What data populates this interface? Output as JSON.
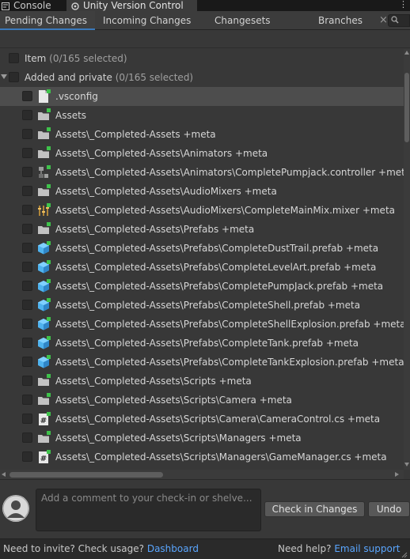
{
  "editor_tabs": {
    "console_label": "Console",
    "uvc_label": "Unity Version Control"
  },
  "sub_tabs": {
    "pending": "Pending Changes",
    "incoming": "Incoming Changes",
    "changesets": "Changesets",
    "branches": "Branches",
    "close_glyph": "×"
  },
  "header_row": {
    "label": "Item",
    "count": "(0/165 selected)"
  },
  "group_row": {
    "label": "Added and private",
    "count": "(0/165 selected)"
  },
  "items": [
    {
      "text": ".vsconfig",
      "icon": "file-icon",
      "selected": true
    },
    {
      "text": "Assets",
      "icon": "folder-icon"
    },
    {
      "text": "Assets\\_Completed-Assets +meta",
      "icon": "folder-icon"
    },
    {
      "text": "Assets\\_Completed-Assets\\Animators +meta",
      "icon": "folder-icon"
    },
    {
      "text": "Assets\\_Completed-Assets\\Animators\\CompletePumpjack.controller +meta",
      "icon": "animator-controller-icon"
    },
    {
      "text": "Assets\\_Completed-Assets\\AudioMixers +meta",
      "icon": "folder-icon"
    },
    {
      "text": "Assets\\_Completed-Assets\\AudioMixers\\CompleteMainMix.mixer +meta",
      "icon": "audio-mixer-icon"
    },
    {
      "text": "Assets\\_Completed-Assets\\Prefabs +meta",
      "icon": "folder-icon"
    },
    {
      "text": "Assets\\_Completed-Assets\\Prefabs\\CompleteDustTrail.prefab +meta",
      "icon": "prefab-icon"
    },
    {
      "text": "Assets\\_Completed-Assets\\Prefabs\\CompleteLevelArt.prefab +meta",
      "icon": "prefab-icon"
    },
    {
      "text": "Assets\\_Completed-Assets\\Prefabs\\CompletePumpJack.prefab +meta",
      "icon": "prefab-icon"
    },
    {
      "text": "Assets\\_Completed-Assets\\Prefabs\\CompleteShell.prefab +meta",
      "icon": "prefab-icon"
    },
    {
      "text": "Assets\\_Completed-Assets\\Prefabs\\CompleteShellExplosion.prefab +meta",
      "icon": "prefab-icon"
    },
    {
      "text": "Assets\\_Completed-Assets\\Prefabs\\CompleteTank.prefab +meta",
      "icon": "prefab-icon"
    },
    {
      "text": "Assets\\_Completed-Assets\\Prefabs\\CompleteTankExplosion.prefab +meta",
      "icon": "prefab-icon"
    },
    {
      "text": "Assets\\_Completed-Assets\\Scripts +meta",
      "icon": "folder-icon"
    },
    {
      "text": "Assets\\_Completed-Assets\\Scripts\\Camera +meta",
      "icon": "folder-icon"
    },
    {
      "text": "Assets\\_Completed-Assets\\Scripts\\Camera\\CameraControl.cs +meta",
      "icon": "csharp-script-icon"
    },
    {
      "text": "Assets\\_Completed-Assets\\Scripts\\Managers +meta",
      "icon": "folder-icon"
    },
    {
      "text": "Assets\\_Completed-Assets\\Scripts\\Managers\\GameManager.cs +meta",
      "icon": "csharp-script-icon"
    }
  ],
  "checkin": {
    "placeholder": "Add a comment to your check-in or shelve...",
    "checkin_button": "Check in Changes",
    "undo_button": "Undo"
  },
  "footer": {
    "invite_text": "Need to invite? Check usage?",
    "dashboard_link": "Dashboard",
    "help_text": "Need help?",
    "support_link": "Email support"
  },
  "colors": {
    "accent": "#3a79bb",
    "link": "#5aa6ff",
    "added_badge": "#3fc24b",
    "prefab": "#4fb3ef"
  }
}
